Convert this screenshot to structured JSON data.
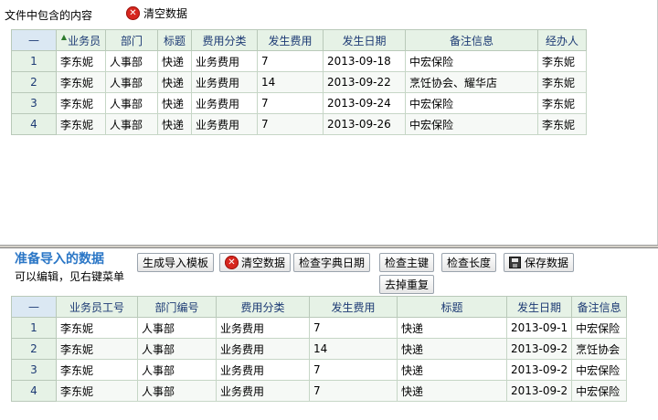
{
  "top_pane": {
    "title": "文件中包含的内容",
    "clear_label": "清空数据",
    "grid": {
      "corner": "—",
      "columns": [
        "业务员",
        "部门",
        "标题",
        "费用分类",
        "发生费用",
        "发生日期",
        "备注信息",
        "经办人"
      ],
      "rows": [
        {
          "num": "1",
          "cells": [
            "李东妮",
            "人事部",
            "快递",
            "业务费用",
            "7",
            "2013-09-18",
            "中宏保险",
            "李东妮"
          ]
        },
        {
          "num": "2",
          "cells": [
            "李东妮",
            "人事部",
            "快递",
            "业务费用",
            "14",
            "2013-09-22",
            "烹饪协会、耀华店",
            "李东妮"
          ]
        },
        {
          "num": "3",
          "cells": [
            "李东妮",
            "人事部",
            "快递",
            "业务费用",
            "7",
            "2013-09-24",
            "中宏保险",
            "李东妮"
          ]
        },
        {
          "num": "4",
          "cells": [
            "李东妮",
            "人事部",
            "快递",
            "业务费用",
            "7",
            "2013-09-26",
            "中宏保险",
            "李东妮"
          ]
        }
      ]
    }
  },
  "bottom_pane": {
    "title": "准备导入的数据",
    "subtitle": "可以编辑，见右键菜单",
    "toolbar": {
      "generate_template": "生成导入模板",
      "clear": "清空数据",
      "check_dict_date": "检查字典日期",
      "check_key": "检查主键",
      "remove_duplicates": "去掉重复",
      "check_length": "检查长度",
      "save": "保存数据"
    },
    "grid": {
      "corner": "—",
      "columns": [
        "业务员工号",
        "部门编号",
        "费用分类",
        "发生费用",
        "标题",
        "发生日期",
        "备注信息"
      ],
      "rows": [
        {
          "num": "1",
          "cells": [
            "李东妮",
            "人事部",
            "业务费用",
            "7",
            "快递",
            "2013-09-1",
            "中宏保险"
          ]
        },
        {
          "num": "2",
          "cells": [
            "李东妮",
            "人事部",
            "业务费用",
            "14",
            "快递",
            "2013-09-2",
            "烹饪协会"
          ]
        },
        {
          "num": "3",
          "cells": [
            "李东妮",
            "人事部",
            "业务费用",
            "7",
            "快递",
            "2013-09-2",
            "中宏保险"
          ]
        },
        {
          "num": "4",
          "cells": [
            "李东妮",
            "人事部",
            "业务费用",
            "7",
            "快递",
            "2013-09-2",
            "中宏保险"
          ]
        }
      ]
    }
  },
  "colors": {
    "header_bg": "#e6f2e6",
    "header_text": "#1c3a74",
    "title_blue": "#2a76c6",
    "clear_icon": "#d7261e"
  },
  "icons": {
    "clear": "red-x-circle-icon",
    "save": "floppy-disk-icon",
    "sort": "sort-asc-icon"
  }
}
